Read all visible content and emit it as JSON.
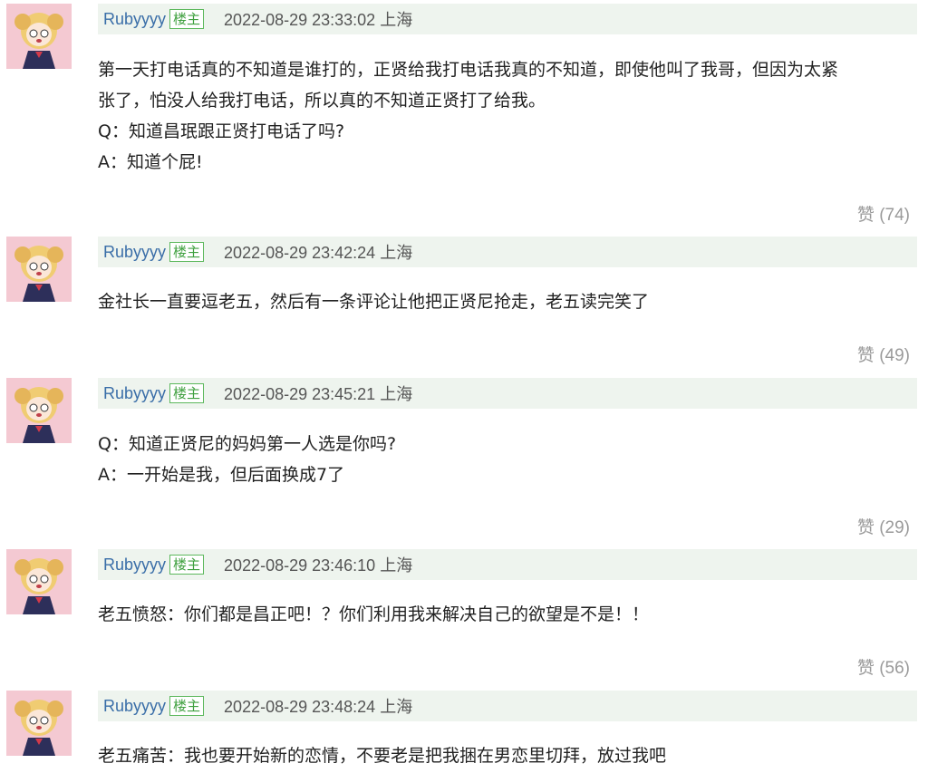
{
  "comments": [
    {
      "username": "Rubyyyy",
      "badge": "楼主",
      "time": "2022-08-29 23:33:02 上海",
      "lines": [
        "第一天打电话真的不知道是谁打的，正贤给我打电话我真的不知道，即使他叫了我哥，但因为太紧",
        "张了，怕没人给我打电话，所以真的不知道正贤打了给我。",
        "Q：知道昌珉跟正贤打电话了吗?",
        "A：知道个屁!"
      ],
      "like_label": "赞 (74)"
    },
    {
      "username": "Rubyyyy",
      "badge": "楼主",
      "time": "2022-08-29 23:42:24 上海",
      "lines": [
        "金社长一直要逗老五，然后有一条评论让他把正贤尼抢走，老五读完笑了"
      ],
      "like_label": "赞 (49)"
    },
    {
      "username": "Rubyyyy",
      "badge": "楼主",
      "time": "2022-08-29 23:45:21 上海",
      "lines": [
        "Q：知道正贤尼的妈妈第一人选是你吗?",
        "A：一开始是我，但后面换成7了"
      ],
      "like_label": "赞 (29)"
    },
    {
      "username": "Rubyyyy",
      "badge": "楼主",
      "time": "2022-08-29 23:46:10 上海",
      "lines": [
        "老五愤怒：你们都是昌正吧！？你们利用我来解决自己的欲望是不是！！"
      ],
      "like_label": "赞 (56)"
    },
    {
      "username": "Rubyyyy",
      "badge": "楼主",
      "time": "2022-08-29 23:48:24 上海",
      "lines": [
        "老五痛苦：我也要开始新的恋情，不要老是把我捆在男恋里切拜，放过我吧"
      ],
      "like_label": ""
    }
  ],
  "colors": {
    "meta_bar_bg": "#eef4ee",
    "username": "#3a6ea8",
    "badge": "#3fa03f",
    "like": "#9a9a9a"
  },
  "icons": {
    "avatar": "anime-girl-avatar-icon"
  }
}
